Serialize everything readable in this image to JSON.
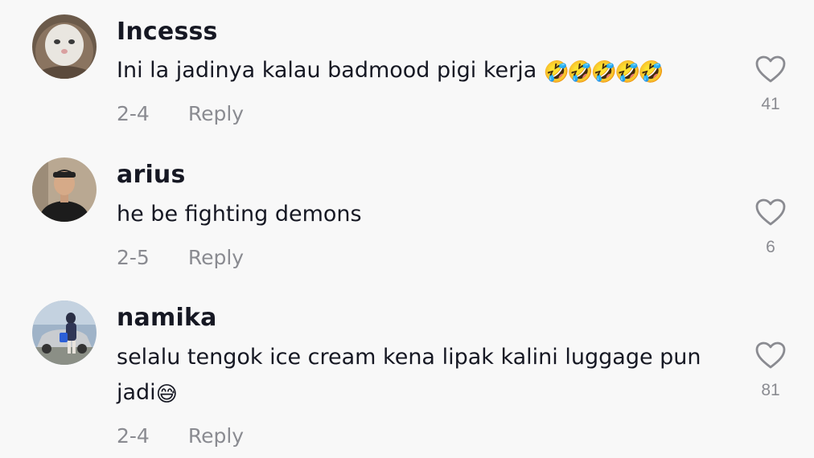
{
  "comments": [
    {
      "username": "Incesss",
      "text": "Ini la jadinya kalau badmood pigi kerja ",
      "emoji": "🤣🤣🤣🤣🤣",
      "date": "2-4",
      "reply": "Reply",
      "likes": "41",
      "avatar_icon": "white-cat-avatar"
    },
    {
      "username": "arius",
      "text": "he be fighting demons",
      "emoji": "",
      "date": "2-5",
      "reply": "Reply",
      "likes": "6",
      "avatar_icon": "man-with-cap-avatar"
    },
    {
      "username": "namika",
      "text": "selalu tengok ice cream kena lipak kalini luggage pun jadi",
      "emoji": "😅",
      "date": "2-4",
      "reply": "Reply",
      "likes": "81",
      "avatar_icon": "person-with-car-avatar"
    }
  ],
  "colors": {
    "background": "#f8f8f8",
    "text": "#161823",
    "muted": "#8a8b91"
  }
}
